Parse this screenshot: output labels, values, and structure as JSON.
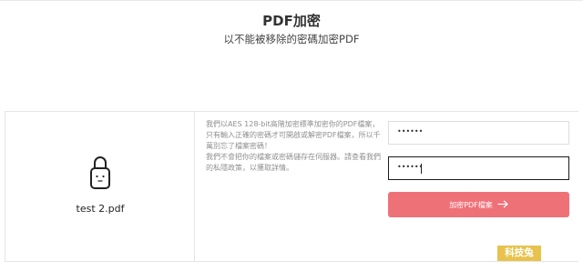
{
  "header": {
    "title": "PDF加密",
    "subtitle": "以不能被移除的密碼加密PDF"
  },
  "file": {
    "name": "test 2.pdf",
    "icon": "lock-file-icon"
  },
  "description": {
    "paragraph1": "我們以AES 128-bit高階加密標準加密你的PDF檔案，只有輸入正確的密碼才可開啟或解密PDF檔案，所以千萬別忘了檔案密碼！",
    "paragraph2": "我們不會把你的檔案或密碼儲存在伺服器。請查看我們的私隱政策，以獲取詳情。"
  },
  "form": {
    "password_mask": "••••••",
    "confirm_mask": "••••••",
    "submit_label": "加密PDF檔案",
    "submit_icon": "arrow-right-icon",
    "accent_color": "#ef7178"
  },
  "watermark": {
    "text": "科技兔",
    "color": "#e7c34d"
  }
}
